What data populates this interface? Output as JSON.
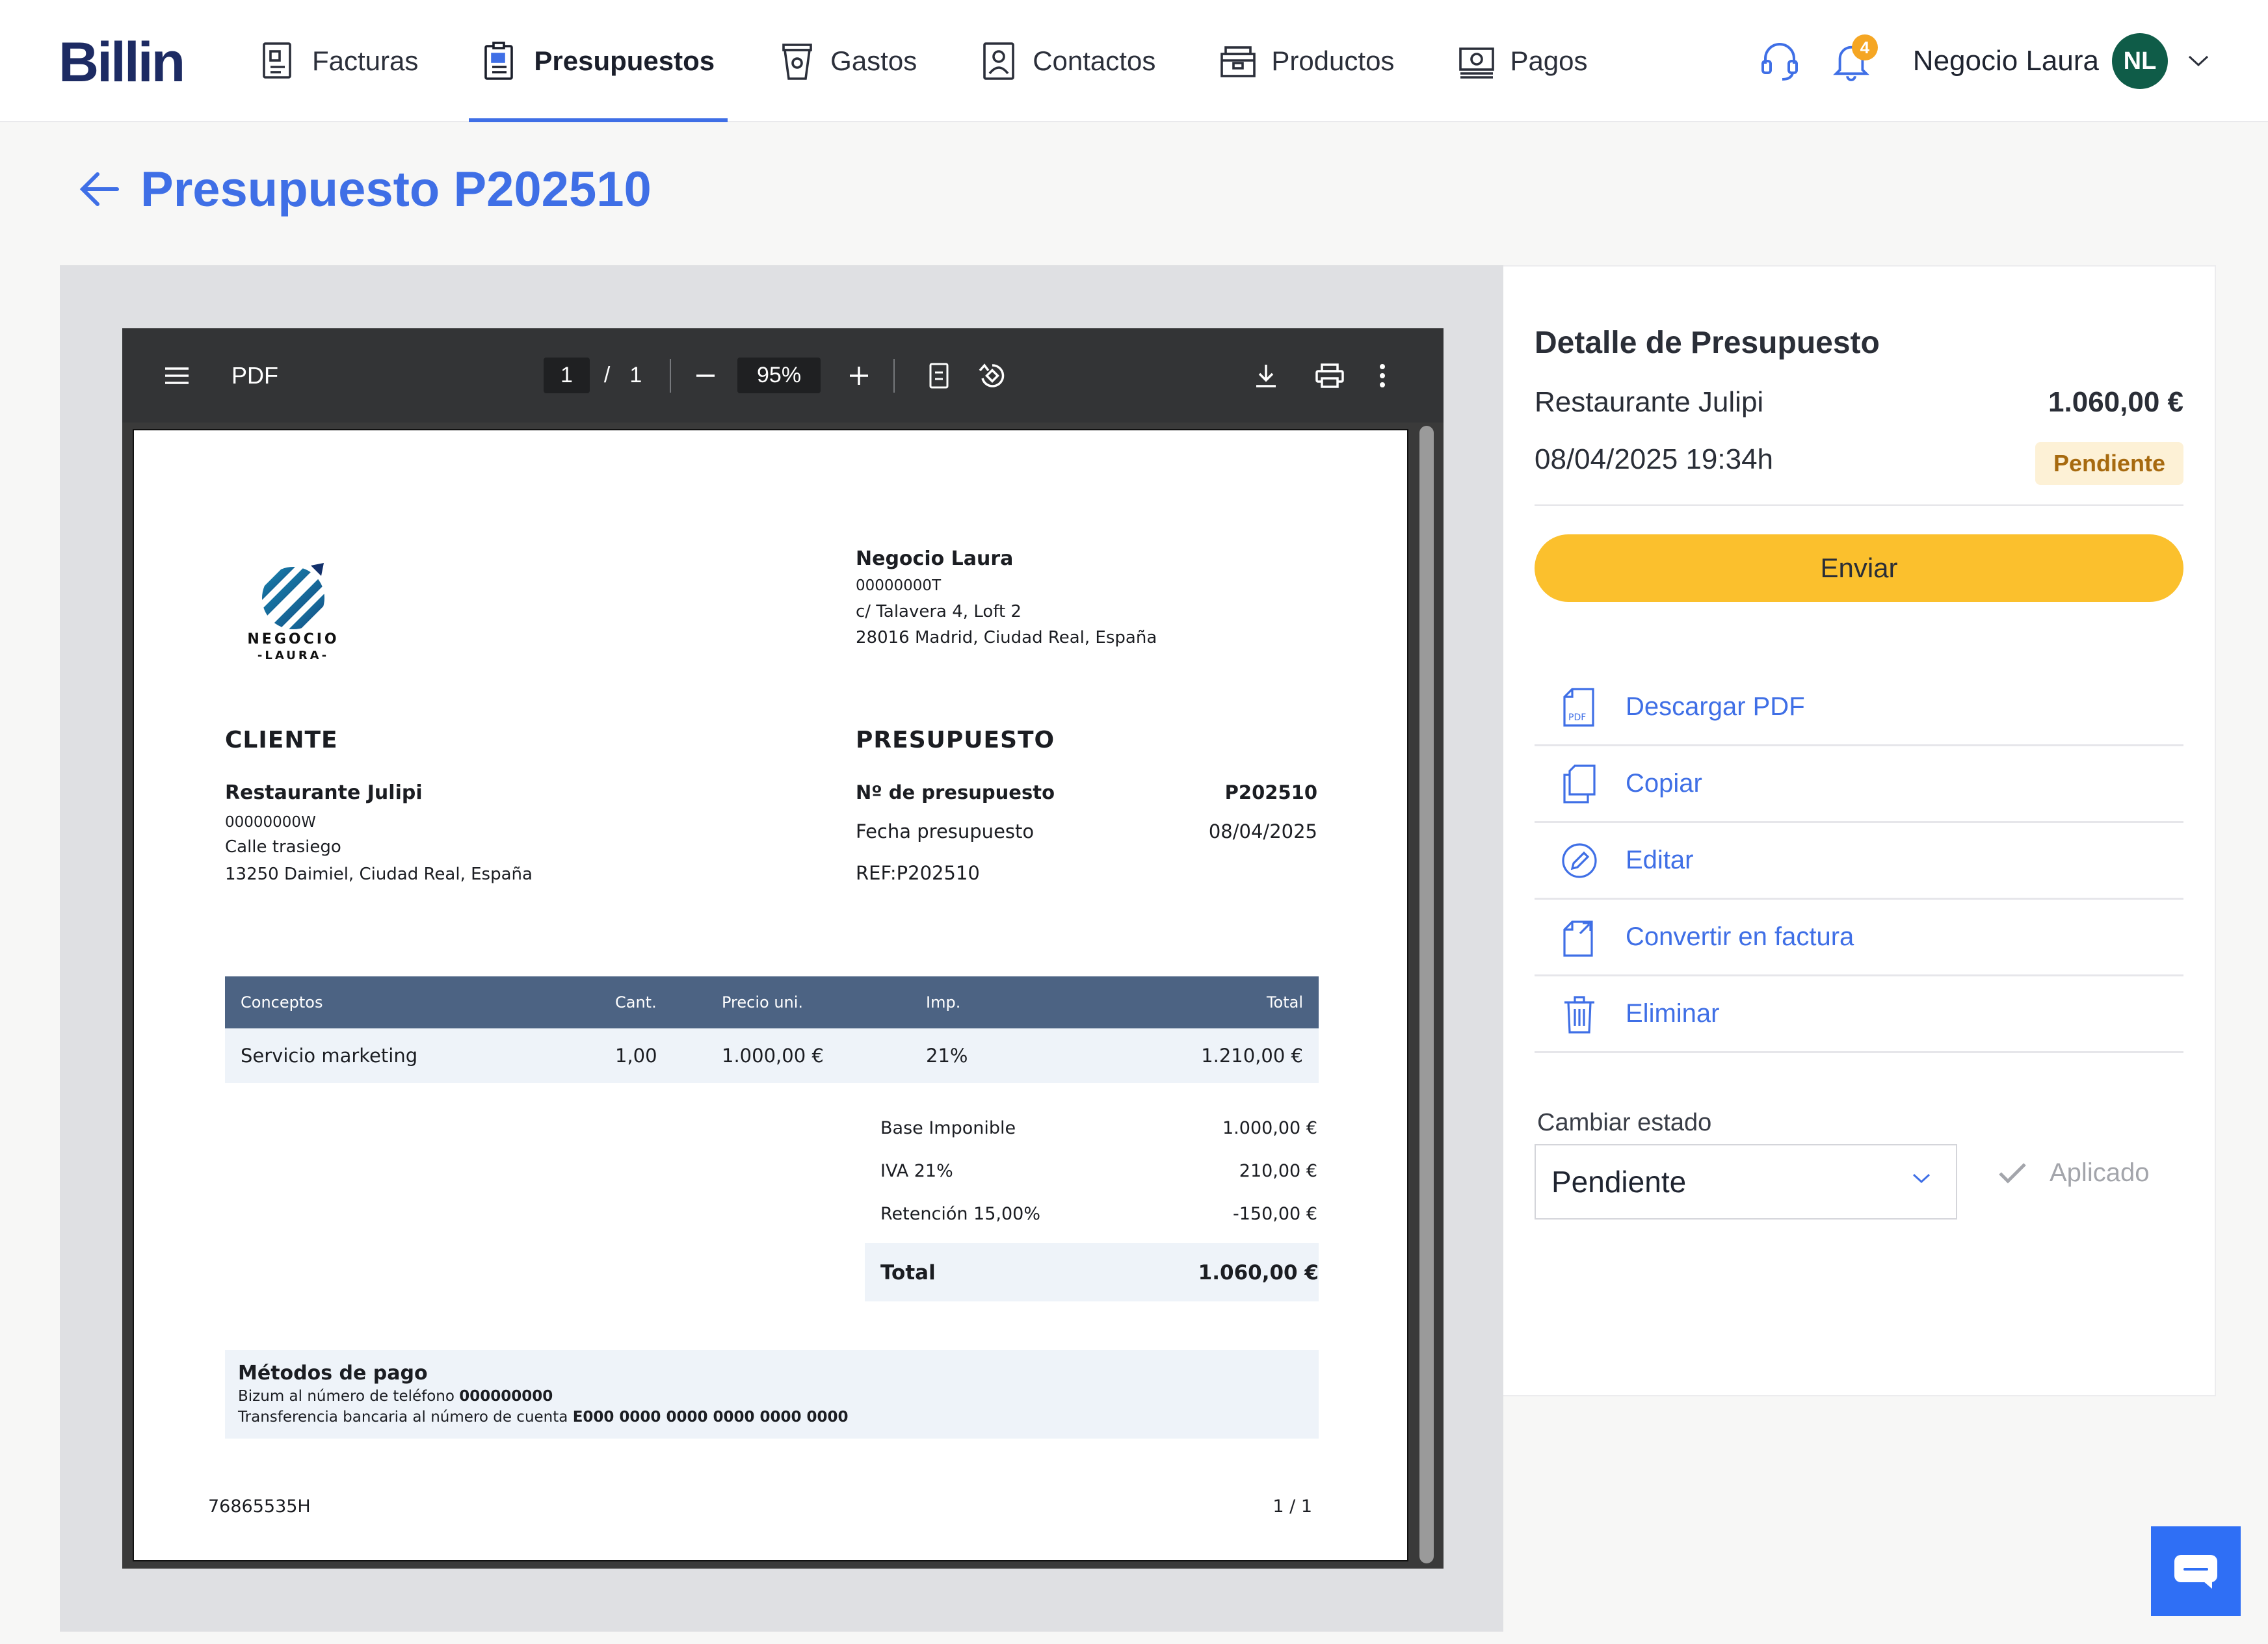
{
  "app": {
    "logo_text": "Billin"
  },
  "nav": {
    "items": [
      {
        "label": "Facturas",
        "icon": "invoice-icon"
      },
      {
        "label": "Presupuestos",
        "icon": "budget-icon",
        "active": true
      },
      {
        "label": "Gastos",
        "icon": "expense-cup-icon"
      },
      {
        "label": "Contactos",
        "icon": "contact-icon"
      },
      {
        "label": "Productos",
        "icon": "product-box-icon"
      },
      {
        "label": "Pagos",
        "icon": "money-icon"
      }
    ],
    "notifications_count": "4",
    "user_name": "Negocio Laura",
    "avatar_initials": "NL"
  },
  "page": {
    "title": "Presupuesto P202510"
  },
  "pdf_viewer": {
    "title": "PDF",
    "current_page": "1",
    "page_separator": "/",
    "total_pages": "1",
    "zoom": "95%"
  },
  "document": {
    "logo_text_1": "NEGOCIO",
    "logo_text_2": "-LAURA-",
    "company": {
      "name": "Negocio Laura",
      "tax_id": "00000000T",
      "address": "c/ Talavera 4, Loft 2",
      "city": "28016 Madrid, Ciudad Real, España"
    },
    "client_heading": "CLIENTE",
    "client": {
      "name": "Restaurante Julipi",
      "tax_id": "00000000W",
      "address": "Calle trasiego",
      "city": "13250 Daimiel, Ciudad Real, España"
    },
    "budget_heading": "PRESUPUESTO",
    "budget_number_label": "Nº de presupuesto",
    "budget_number": "P202510",
    "budget_date_label": "Fecha presupuesto",
    "budget_date": "08/04/2025",
    "reference": "REF:P202510",
    "table": {
      "headers": [
        "Conceptos",
        "Cant.",
        "Precio uni.",
        "Imp.",
        "Total"
      ],
      "rows": [
        [
          "Servicio marketing",
          "1,00",
          "1.000,00 €",
          "21%",
          "1.210,00 €"
        ]
      ]
    },
    "summary": [
      {
        "label": "Base Imponible",
        "value": "1.000,00 €"
      },
      {
        "label": "IVA 21%",
        "value": "210,00 €"
      },
      {
        "label": "Retención 15,00%",
        "value": "-150,00 €"
      }
    ],
    "total_label": "Total",
    "total_value": "1.060,00 €",
    "payment": {
      "title": "Métodos de pago",
      "line1_prefix": "Bizum al número de teléfono",
      "line1_value": "000000000",
      "line2_prefix": "Transferencia bancaria al número de cuenta",
      "line2_value": "E000 0000 0000 0000 0000 0000"
    },
    "footer_id": "76865535H",
    "footer_page": "1 / 1"
  },
  "panel": {
    "title": "Detalle de Presupuesto",
    "client_name": "Restaurante Julipi",
    "amount": "1.060,00 €",
    "datetime": "08/04/2025 19:34h",
    "status": "Pendiente",
    "send_label": "Enviar",
    "actions": [
      {
        "label": "Descargar PDF",
        "icon": "pdf-download-icon"
      },
      {
        "label": "Copiar",
        "icon": "copy-icon"
      },
      {
        "label": "Editar",
        "icon": "edit-pencil-icon"
      },
      {
        "label": "Convertir en factura",
        "icon": "convert-icon"
      },
      {
        "label": "Eliminar",
        "icon": "trash-icon"
      }
    ],
    "change_state_label": "Cambiar estado",
    "state_value": "Pendiente",
    "apply_label": "Aplicado"
  },
  "colors": {
    "accent": "#3f6fe6",
    "send_button": "#fbc02d",
    "status_bg": "#fdf1d6",
    "status_text": "#a76a0f",
    "avatar_bg": "#0f5c48",
    "table_header": "#4c6383",
    "chat_button": "#2f6ff5"
  }
}
